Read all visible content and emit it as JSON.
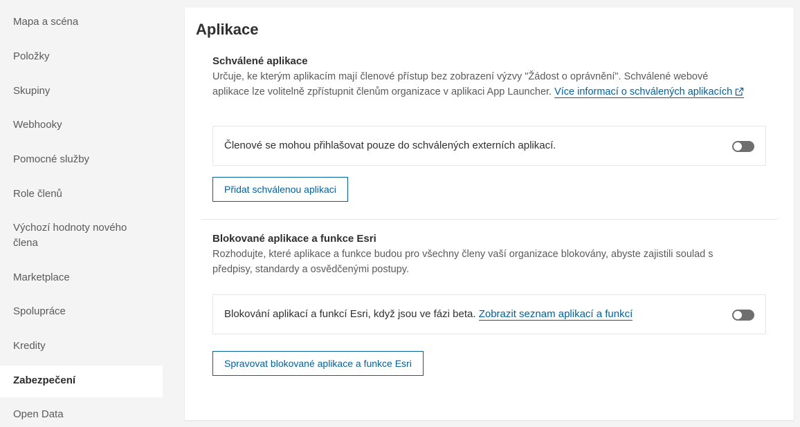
{
  "sidebar": {
    "items": [
      {
        "label": "Mapa a scéna"
      },
      {
        "label": "Položky"
      },
      {
        "label": "Skupiny"
      },
      {
        "label": "Webhooky"
      },
      {
        "label": "Pomocné služby"
      },
      {
        "label": "Role členů"
      },
      {
        "label": "Výchozí hodnoty nového člena"
      },
      {
        "label": "Marketplace"
      },
      {
        "label": "Spolupráce"
      },
      {
        "label": "Kredity"
      },
      {
        "label": "Zabezpečení"
      },
      {
        "label": "Open Data"
      }
    ],
    "active_item": "Zabezpečení"
  },
  "main": {
    "title": "Aplikace",
    "approved": {
      "title": "Schválené aplikace",
      "description": "Určuje, ke kterým aplikacím mají členové přístup bez zobrazení výzvy \"Žádost o oprávnění\". Schválené webové aplikace lze volitelně zpřístupnit členům organizace v aplikaci App Launcher.",
      "link_text": "Více informací o schválených aplikacích",
      "link_icon": "external-link-icon",
      "toggle_label": "Členové se mohou přihlašovat pouze do schválených externích aplikací.",
      "toggle_state": "off",
      "button_label": "Přidat schválenou aplikaci"
    },
    "blocked": {
      "title": "Blokované aplikace a funkce Esri",
      "description": "Rozhodujte, které aplikace a funkce budou pro všechny členy vaší organizace blokovány, abyste zajistili soulad s předpisy, standardy a osvědčenými postupy.",
      "toggle_label": "Blokování aplikací a funkcí Esri, když jsou ve fázi beta.",
      "toggle_link": "Zobrazit seznam aplikací a funkcí",
      "toggle_state": "off",
      "button_label": "Spravovat blokované aplikace a funkce Esri"
    }
  },
  "colors": {
    "accent": "#00619b",
    "toggle_off": "#6e6e6e",
    "background": "#f4f4f4"
  }
}
